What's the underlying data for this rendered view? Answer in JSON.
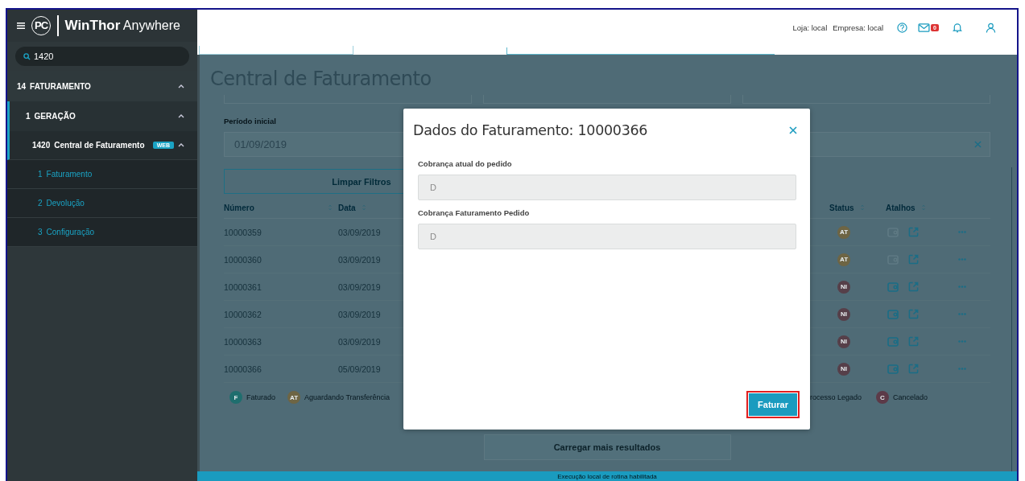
{
  "topbar": {
    "store": "Loja: local",
    "company": "Empresa: local",
    "mail_count": "0"
  },
  "sidebar": {
    "logo": {
      "mark": "PC",
      "brand_bold": "WinThor",
      "brand_light": "Anywhere"
    },
    "search": {
      "value": "1420"
    },
    "items": [
      {
        "number": "14",
        "label": "FATURAMENTO",
        "expanded": true,
        "children": [
          {
            "number": "1",
            "label": "GERAÇÃO",
            "expanded": true,
            "children": [
              {
                "number": "1420",
                "label": "Central de Faturamento",
                "badge": "WEB",
                "expanded": true,
                "children": [
                  {
                    "number": "1",
                    "label": "Faturamento"
                  },
                  {
                    "number": "2",
                    "label": "Devolução"
                  },
                  {
                    "number": "3",
                    "label": "Configuração"
                  }
                ]
              }
            ]
          }
        ]
      }
    ]
  },
  "page": {
    "title": "Central de Faturamento",
    "period_label": "Período inicial",
    "period_value": "01/09/2019",
    "clear_button": "Limpar Filtros",
    "table": {
      "columns": [
        "Número",
        "Data",
        "Status",
        "Atalhos"
      ],
      "rows": [
        {
          "number": "10000359",
          "date": "03/09/2019",
          "status": {
            "code": "AT",
            "color": "#6e6544"
          },
          "invoice_enabled": false
        },
        {
          "number": "10000360",
          "date": "03/09/2019",
          "status": {
            "code": "AT",
            "color": "#6e6544"
          },
          "invoice_enabled": false
        },
        {
          "number": "10000361",
          "date": "03/09/2019",
          "status": {
            "code": "NI",
            "color": "#563f49"
          },
          "invoice_enabled": true
        },
        {
          "number": "10000362",
          "date": "03/09/2019",
          "status": {
            "code": "NI",
            "color": "#563f49"
          },
          "invoice_enabled": true
        },
        {
          "number": "10000363",
          "date": "03/09/2019",
          "status": {
            "code": "NI",
            "color": "#563f49"
          },
          "invoice_enabled": true
        },
        {
          "number": "10000366",
          "date": "05/09/2019",
          "status": {
            "code": "NI",
            "color": "#563f49"
          },
          "invoice_enabled": true
        }
      ]
    },
    "legend": [
      {
        "code": "F",
        "label": "Faturado",
        "color": "#1f6e6e"
      },
      {
        "code": "AT",
        "label": "Aguardando Transferência",
        "color": "#6e6544"
      },
      {
        "label": "rocesso Legado"
      },
      {
        "code": "C",
        "label": "Cancelado",
        "color": "#5c3a48"
      }
    ],
    "load_more": "Carregar mais resultados"
  },
  "dialog": {
    "title": "Dados do Faturamento: 10000366",
    "fields": [
      {
        "label": "Cobrança atual do pedido",
        "value": "D",
        "disabled": true
      },
      {
        "label": "Cobrança Faturamento Pedido",
        "value": "D",
        "disabled": true
      }
    ],
    "submit": "Faturar"
  },
  "status_bar": {
    "text": "Execução local de rotina habilitada"
  }
}
